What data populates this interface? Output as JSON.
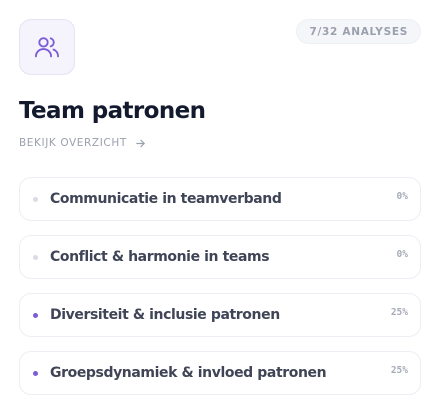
{
  "header": {
    "icon": "users-icon",
    "badge": "7/32 ANALYSES",
    "title": "Team patronen",
    "link_label": "BEKIJK OVERZICHT",
    "link_icon": "arrow-right-icon"
  },
  "colors": {
    "accent": "#7c5cd6",
    "inactive_dot": "#d9dce3",
    "title": "#141a2e"
  },
  "items": [
    {
      "label": "Communicatie in teamverband",
      "percent": "0%",
      "active": false
    },
    {
      "label": "Conflict & harmonie in teams",
      "percent": "0%",
      "active": false
    },
    {
      "label": "Diversiteit & inclusie patronen",
      "percent": "25%",
      "active": true
    },
    {
      "label": "Groepsdynamiek & invloed patronen",
      "percent": "25%",
      "active": true
    }
  ]
}
